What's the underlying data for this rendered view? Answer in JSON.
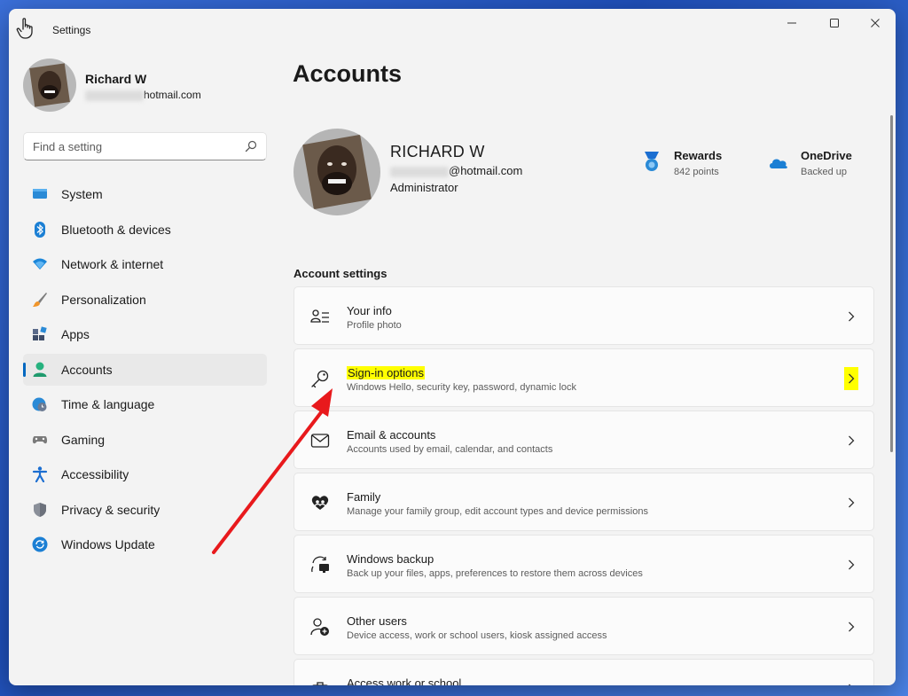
{
  "window": {
    "title": "Settings"
  },
  "profile": {
    "name": "Richard W",
    "email_suffix": "hotmail.com"
  },
  "search": {
    "placeholder": "Find a setting"
  },
  "nav": {
    "items": [
      {
        "label": "System",
        "icon": "monitor-icon"
      },
      {
        "label": "Bluetooth & devices",
        "icon": "bluetooth-icon"
      },
      {
        "label": "Network & internet",
        "icon": "wifi-icon"
      },
      {
        "label": "Personalization",
        "icon": "brush-icon"
      },
      {
        "label": "Apps",
        "icon": "apps-icon"
      },
      {
        "label": "Accounts",
        "icon": "person-icon",
        "active": true
      },
      {
        "label": "Time & language",
        "icon": "globe-clock-icon"
      },
      {
        "label": "Gaming",
        "icon": "gamepad-icon"
      },
      {
        "label": "Accessibility",
        "icon": "accessibility-icon"
      },
      {
        "label": "Privacy & security",
        "icon": "shield-icon"
      },
      {
        "label": "Windows Update",
        "icon": "update-icon"
      }
    ]
  },
  "main": {
    "title": "Accounts",
    "account": {
      "name": "RICHARD W",
      "email_suffix": "@hotmail.com",
      "role": "Administrator"
    },
    "rewards": {
      "title": "Rewards",
      "sub": "842 points"
    },
    "onedrive": {
      "title": "OneDrive",
      "sub": "Backed up"
    },
    "section_label": "Account settings",
    "cards": [
      {
        "title": "Your info",
        "sub": "Profile photo",
        "icon": "your-info-icon"
      },
      {
        "title": "Sign-in options",
        "sub": "Windows Hello, security key, password, dynamic lock",
        "icon": "key-icon",
        "highlighted": true
      },
      {
        "title": "Email & accounts",
        "sub": "Accounts used by email, calendar, and contacts",
        "icon": "mail-icon"
      },
      {
        "title": "Family",
        "sub": "Manage your family group, edit account types and device permissions",
        "icon": "family-heart-icon"
      },
      {
        "title": "Windows backup",
        "sub": "Back up your files, apps, preferences to restore them across devices",
        "icon": "backup-icon"
      },
      {
        "title": "Other users",
        "sub": "Device access, work or school users, kiosk assigned access",
        "icon": "add-user-icon"
      },
      {
        "title": "Access work or school",
        "sub": "",
        "icon": "briefcase-icon"
      }
    ]
  },
  "colors": {
    "accent": "#0067c0",
    "highlight": "#ffff00",
    "arrow": "#e8191c"
  }
}
